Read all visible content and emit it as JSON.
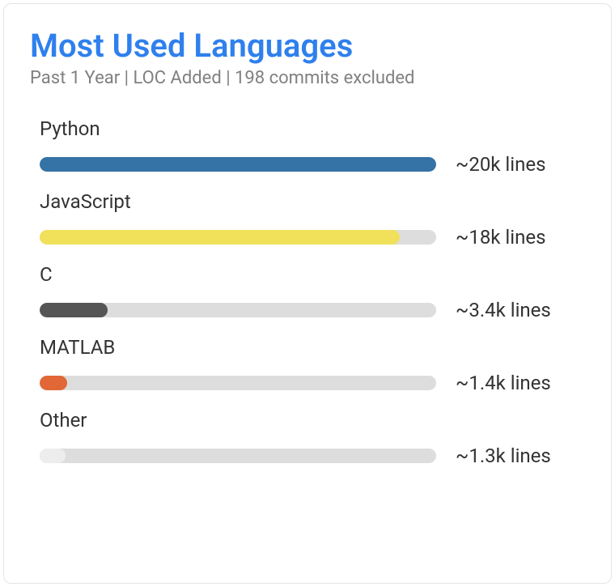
{
  "title": "Most Used Languages",
  "subtitle": "Past 1 Year | LOC Added | 198 commits excluded",
  "languages": [
    {
      "name": "Python",
      "value_label": "~20k lines",
      "percent": 100,
      "color": "#3572a5"
    },
    {
      "name": "JavaScript",
      "value_label": "~18k lines",
      "percent": 90.9,
      "color": "#f1e05a"
    },
    {
      "name": "C",
      "value_label": "~3.4k lines",
      "percent": 17.1,
      "color": "#555555"
    },
    {
      "name": "MATLAB",
      "value_label": "~1.4k lines",
      "percent": 7.0,
      "color": "#e16737"
    },
    {
      "name": "Other",
      "value_label": "~1.3k lines",
      "percent": 6.5,
      "color": "#ededed"
    }
  ],
  "chart_data": {
    "type": "bar",
    "title": "Most Used Languages",
    "subtitle": "Past 1 Year | LOC Added | 198 commits excluded",
    "categories": [
      "Python",
      "JavaScript",
      "C",
      "MATLAB",
      "Other"
    ],
    "values": [
      20000,
      18000,
      3400,
      1400,
      1300
    ],
    "value_labels": [
      "~20k lines",
      "~18k lines",
      "~3.4k lines",
      "~1.4k lines",
      "~1.3k lines"
    ],
    "colors": [
      "#3572a5",
      "#f1e05a",
      "#555555",
      "#e16737",
      "#ededed"
    ],
    "xlabel": "",
    "ylabel": "LOC Added",
    "ylim": [
      0,
      20000
    ]
  }
}
